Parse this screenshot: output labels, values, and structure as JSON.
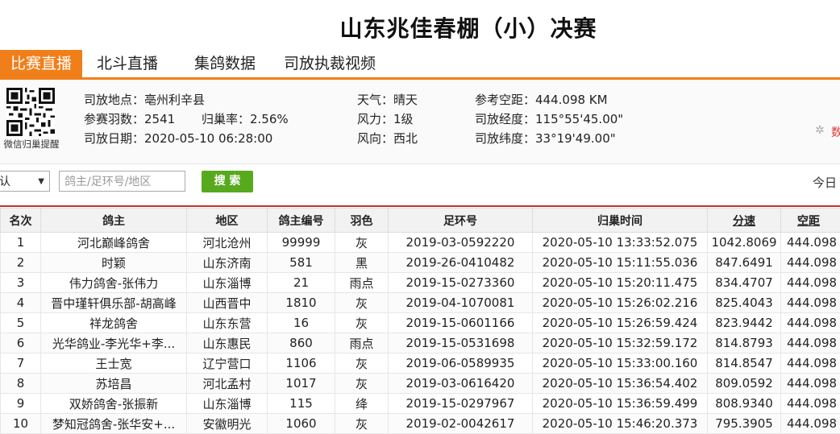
{
  "title": "山东兆佳春棚（小）决赛",
  "tabs": [
    {
      "label": "比赛直播"
    },
    {
      "label": "北斗直播"
    },
    {
      "label": "集鸽数据"
    },
    {
      "label": "司放执裁视频"
    }
  ],
  "info": {
    "qr_label": "微信归巢提醒",
    "location": "司放地点：亳州利辛县",
    "count": "参赛羽数：2541",
    "return_rate": "归巢率：2.56%",
    "date": "司放日期：2020-05-10 06:28:00",
    "weather": "天气：晴天",
    "wind_force": "风力：1级",
    "wind_dir": "风向：西北",
    "distance": "参考空距：444.098 KM",
    "longitude": "司放经度：115°55'45.00\"",
    "latitude": "司放纬度：33°19'49.00\"",
    "loading_text": "数"
  },
  "filter": {
    "select_value": "认",
    "search_placeholder": "鸽主/足环号/地区",
    "search_button": "搜 索",
    "today": "今日"
  },
  "table": {
    "headers": [
      "名次",
      "鸽主",
      "地区",
      "鸽主编号",
      "羽色",
      "足环号",
      "归巢时间",
      "分速",
      "空距"
    ],
    "rows": [
      [
        "1",
        "河北巅峰鸽舍",
        "河北沧州",
        "99999",
        "灰",
        "2019-03-0592220",
        "2020-05-10 13:33:52.075",
        "1042.8069",
        "444.098"
      ],
      [
        "2",
        "时颖",
        "山东济南",
        "581",
        "黑",
        "2019-26-0410482",
        "2020-05-10 15:11:55.036",
        "847.6491",
        "444.098"
      ],
      [
        "3",
        "伟力鸽舍-张伟力",
        "山东淄博",
        "21",
        "雨点",
        "2019-15-0273360",
        "2020-05-10 15:20:11.475",
        "834.4707",
        "444.098"
      ],
      [
        "4",
        "晋中瑾轩俱乐部-胡高峰",
        "山西晋中",
        "1810",
        "灰",
        "2019-04-1070081",
        "2020-05-10 15:26:02.216",
        "825.4043",
        "444.098"
      ],
      [
        "5",
        "祥龙鸽舍",
        "山东东营",
        "16",
        "灰",
        "2019-15-0601166",
        "2020-05-10 15:26:59.424",
        "823.9442",
        "444.098"
      ],
      [
        "6",
        "光华鸽业-李光华+李...",
        "山东惠民",
        "860",
        "雨点",
        "2019-15-0531698",
        "2020-05-10 15:32:59.172",
        "814.8793",
        "444.098"
      ],
      [
        "7",
        "王士宽",
        "辽宁营口",
        "1106",
        "灰",
        "2019-06-0589935",
        "2020-05-10 15:33:00.160",
        "814.8547",
        "444.098"
      ],
      [
        "8",
        "苏培昌",
        "河北孟村",
        "1017",
        "灰",
        "2019-03-0616420",
        "2020-05-10 15:36:54.402",
        "809.0592",
        "444.098"
      ],
      [
        "9",
        "双娇鸽舍-张振新",
        "山东淄博",
        "115",
        "绛",
        "2019-15-0297967",
        "2020-05-10 15:36:59.499",
        "808.9340",
        "444.098"
      ],
      [
        "10",
        "梦知冠鸽舍-张华安+...",
        "安徽明光",
        "1060",
        "灰",
        "2019-02-0042617",
        "2020-05-10 15:46:20.373",
        "795.3905",
        "444.098"
      ]
    ]
  }
}
